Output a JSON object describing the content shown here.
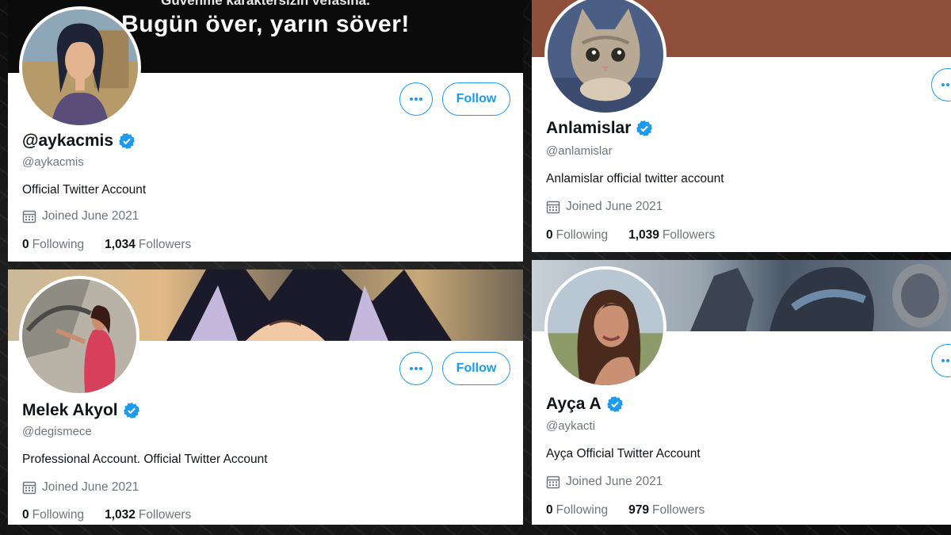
{
  "banner_text": {
    "line1": "Güvenme karaktersizin vefasına.",
    "line2": "Bugün över, yarın söver!"
  },
  "colors": {
    "accent": "#1d9bf0",
    "verified": "#1d9bf0",
    "banner_brown": "#8f4e3a"
  },
  "buttons": {
    "follow_label": "Follow",
    "more_icon": "more-dots-icon"
  },
  "profiles": [
    {
      "display_name": "@aykacmis",
      "handle": "@aykacmis",
      "bio": "Official Twitter Account",
      "joined": "Joined June 2021",
      "following_count": "0",
      "following_label": "Following",
      "followers_count": "1,034",
      "followers_label": "Followers"
    },
    {
      "display_name": "Anlamislar",
      "handle": "@anlamislar",
      "bio": "Anlamislar official twitter account",
      "joined": "Joined June 2021",
      "following_count": "0",
      "following_label": "Following",
      "followers_count": "1,039",
      "followers_label": "Followers"
    },
    {
      "display_name": "Melek Akyol",
      "handle": "@degismece",
      "bio": "Professional Account. Official Twitter Account",
      "joined": "Joined June 2021",
      "following_count": "0",
      "following_label": "Following",
      "followers_count": "1,032",
      "followers_label": "Followers"
    },
    {
      "display_name": "Ayça A",
      "handle": "@aykacti",
      "bio": "Ayça Official Twitter Account",
      "joined": "Joined June 2021",
      "following_count": "0",
      "following_label": "Following",
      "followers_count": "979",
      "followers_label": "Followers"
    }
  ]
}
